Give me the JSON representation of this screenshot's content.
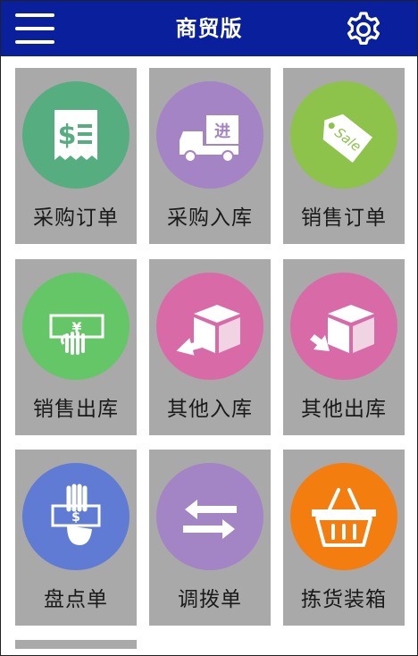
{
  "header": {
    "title": "商贸版",
    "menu_icon": "hamburger-menu-icon",
    "settings_icon": "gear-icon",
    "background_color": "#0a1f9c"
  },
  "tile_background": "#a9a9a9",
  "tiles": [
    {
      "label": "采购订单",
      "icon": "receipt-dollar-icon",
      "color": "#56ad80"
    },
    {
      "label": "采购入库",
      "icon": "truck-inbound-icon",
      "color": "#a484c4"
    },
    {
      "label": "销售订单",
      "icon": "sale-tag-icon",
      "color": "#8dc34a"
    },
    {
      "label": "销售出库",
      "icon": "cash-out-icon",
      "color": "#64c667"
    },
    {
      "label": "其他入库",
      "icon": "box-inbound-icon",
      "color": "#d96aa8"
    },
    {
      "label": "其他出库",
      "icon": "box-outbound-icon",
      "color": "#d96aa8"
    },
    {
      "label": "盘点单",
      "icon": "hand-money-icon",
      "color": "#5f7bd3"
    },
    {
      "label": "调拨单",
      "icon": "transfer-arrows-icon",
      "color": "#a384c5"
    },
    {
      "label": "拣货装箱",
      "icon": "basket-icon",
      "color": "#f47d0f"
    }
  ]
}
